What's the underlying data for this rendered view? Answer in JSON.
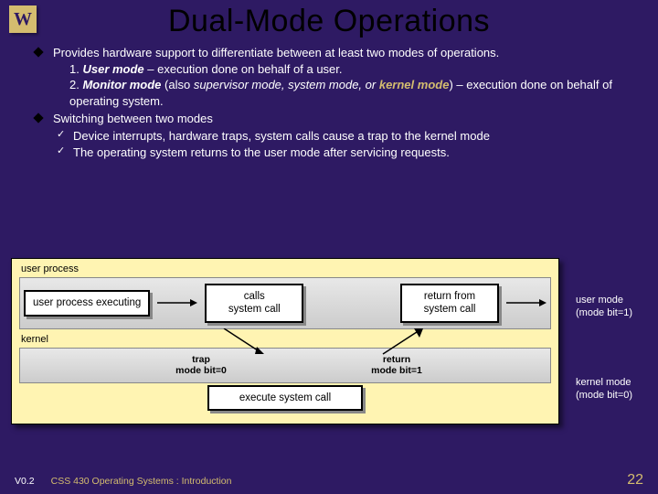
{
  "logo": "W",
  "title": "Dual-Mode Operations",
  "bullets": {
    "b1": {
      "intro": "Provides hardware support to differentiate between at least two modes of operations.",
      "item1_num": "1. ",
      "item1_term": "User mode",
      "item1_rest": " – execution done on behalf of a user.",
      "item2_num": "2. ",
      "item2_term": "Monitor mode",
      "item2_rest_a": " (also ",
      "item2_ital": "supervisor mode, system mode, or ",
      "item2_kernel": "kernel mode",
      "item2_rest_b": ") – execution done on behalf of operating system."
    },
    "b2": {
      "intro": "Switching between two modes",
      "sub1": "Device interrupts, hardware traps, system calls cause a trap to the kernel mode",
      "sub2": "The operating system returns to the user mode after servicing requests."
    }
  },
  "diagram": {
    "user_label": "user process",
    "kernel_label": "kernel",
    "n1": "user process executing",
    "n2": "calls\nsystem call",
    "n3": "return from\nsystem call",
    "n4": "execute system call",
    "a_trap_l1": "trap",
    "a_trap_l2": "mode bit=0",
    "a_ret_l1": "return",
    "a_ret_l2": "mode bit=1",
    "side_user_l1": "user mode",
    "side_user_l2": "(mode bit=1)",
    "side_kernel_l1": "kernel mode",
    "side_kernel_l2": "(mode bit=0)"
  },
  "footer": {
    "version": "V0.2",
    "course": "CSS 430 Operating Systems : Introduction",
    "page": "22"
  }
}
